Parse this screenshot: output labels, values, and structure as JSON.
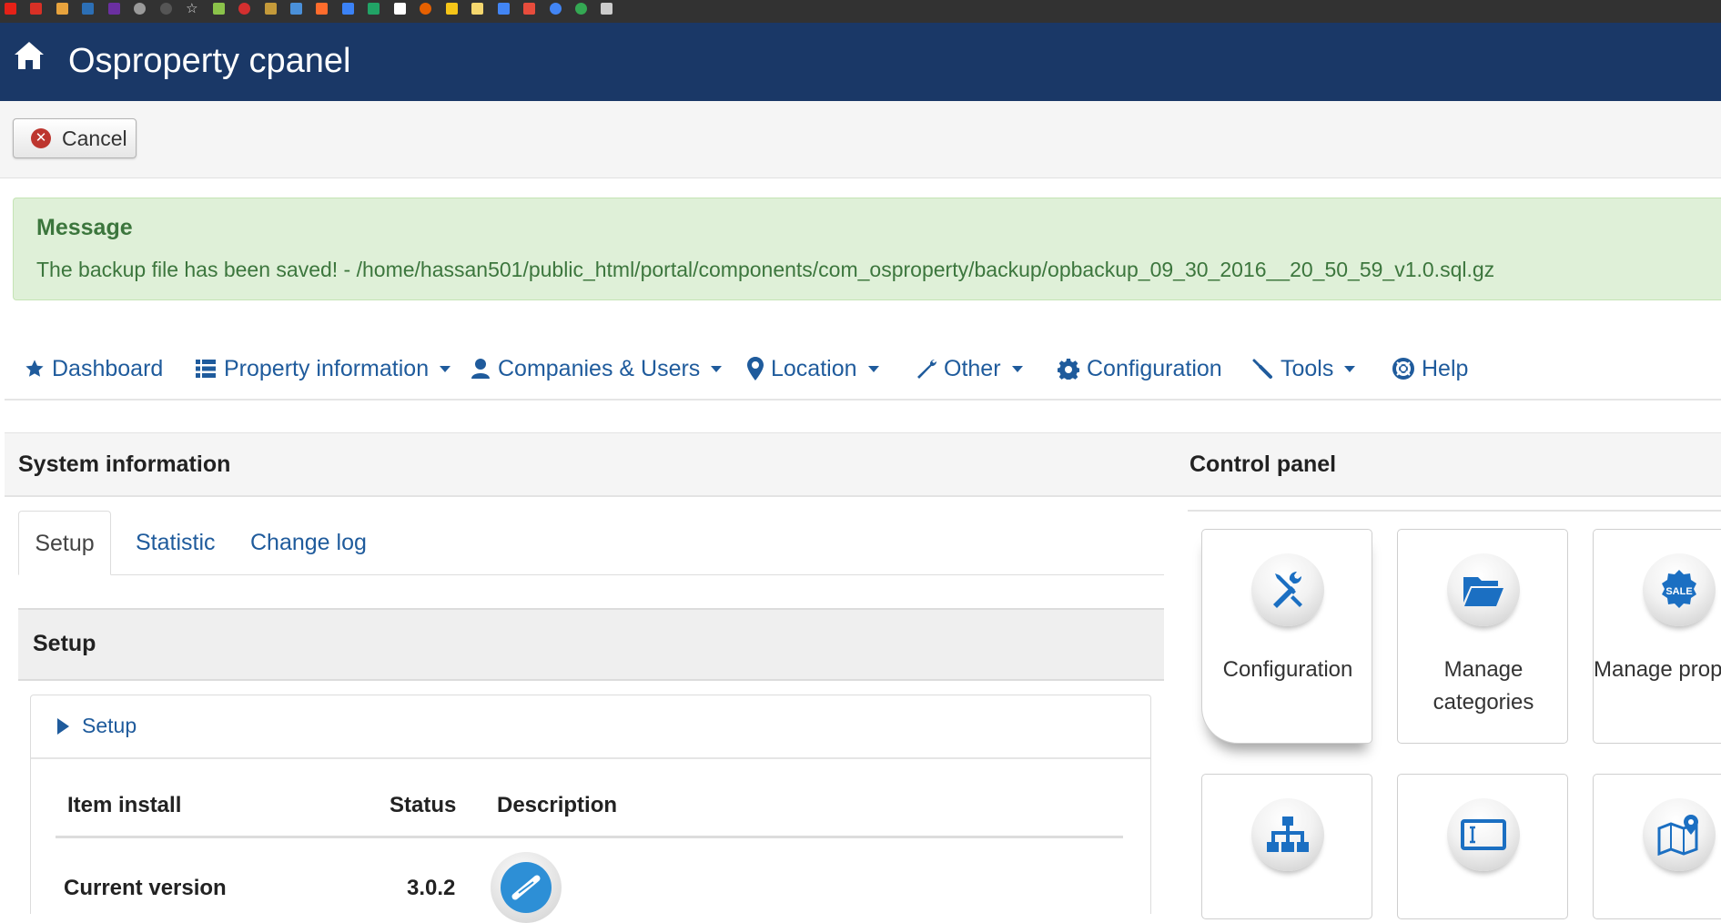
{
  "bookmarks": [
    {
      "icon": "youtube-icon",
      "color": "#e62117"
    },
    {
      "icon": "gmail-icon",
      "color": "#d93025"
    },
    {
      "icon": "bookmark-icon",
      "color": "#e8a33d"
    },
    {
      "icon": "m-icon",
      "color": "#2c6fb5"
    },
    {
      "icon": "yahoo-mail-icon",
      "color": "#6b2fa1"
    },
    {
      "icon": "apple-icon",
      "color": "#9a9a9a"
    },
    {
      "icon": "apple-icon-dim",
      "color": "#555555"
    },
    {
      "icon": "star-icon",
      "color": "#dddddd"
    },
    {
      "icon": "android-icon",
      "color": "#8bc34a"
    },
    {
      "icon": "opera-icon",
      "color": "#d32f2f"
    },
    {
      "icon": "fiverr-icon",
      "color": "#c49a3a"
    },
    {
      "icon": "docs-icon",
      "color": "#4a90d9"
    },
    {
      "icon": "cpanel-icon",
      "color": "#ff6c2c"
    },
    {
      "icon": "drive-icon",
      "color": "#3b82f6"
    },
    {
      "icon": "sheets-icon",
      "color": "#21a366"
    },
    {
      "icon": "medium-icon",
      "color": "#ffffff"
    },
    {
      "icon": "firefox-icon",
      "color": "#e66000"
    },
    {
      "icon": "bulb-icon",
      "color": "#f5c518"
    },
    {
      "icon": "note-icon",
      "color": "#f5d76e"
    },
    {
      "icon": "translate-icon",
      "color": "#4285f4"
    },
    {
      "icon": "puzzle-icon",
      "color": "#e74c3c"
    },
    {
      "icon": "google-icon",
      "color": "#4285f4"
    },
    {
      "icon": "google-icon-2",
      "color": "#34a853"
    },
    {
      "icon": "pin-icon",
      "color": "#cccccc"
    }
  ],
  "header": {
    "title": "Osproperty cpanel",
    "background": "#1a3867"
  },
  "toolbar": {
    "cancel_label": "Cancel"
  },
  "message": {
    "heading": "Message",
    "text": "The backup file has been saved! - /home/hassan501/public_html/portal/components/com_osproperty/backup/opbackup_09_30_2016__20_50_59_v1.0.sql.gz"
  },
  "nav": [
    {
      "label": "Dashboard",
      "icon": "star-icon",
      "dropdown": false
    },
    {
      "label": "Property information",
      "icon": "list-icon",
      "dropdown": true
    },
    {
      "label": "Companies & Users",
      "icon": "user-icon",
      "dropdown": true
    },
    {
      "label": "Location",
      "icon": "map-marker-icon",
      "dropdown": true
    },
    {
      "label": "Other",
      "icon": "wrench-icon",
      "dropdown": true
    },
    {
      "label": "Configuration",
      "icon": "gear-icon",
      "dropdown": false
    },
    {
      "label": "Tools",
      "icon": "screwdriver-icon",
      "dropdown": true
    },
    {
      "label": "Help",
      "icon": "lifebuoy-icon",
      "dropdown": false
    }
  ],
  "system_panel": {
    "title": "System information",
    "tabs": [
      "Setup",
      "Statistic",
      "Change log"
    ],
    "active_tab": "Setup",
    "section_title": "Setup",
    "toggle_label": "Setup",
    "table": {
      "headers": [
        "Item install",
        "Status",
        "Description"
      ],
      "rows": [
        {
          "item": "Current version",
          "status": "3.0.2"
        }
      ]
    }
  },
  "control_panel": {
    "title": "Control panel",
    "tiles": [
      {
        "label": "Configuration",
        "icon": "tools-icon"
      },
      {
        "label": "Manage categories",
        "icon": "folder-icon"
      },
      {
        "label": "Manage prop types",
        "icon": "sale-badge-icon"
      },
      {
        "label": "",
        "icon": "sitemap-icon"
      },
      {
        "label": "",
        "icon": "text-field-icon"
      },
      {
        "label": "",
        "icon": "map-icon"
      }
    ]
  },
  "colors": {
    "link": "#1f5b9c",
    "message_bg": "#dff0d8",
    "message_text": "#3c763d",
    "cancel_icon": "#bd362f"
  }
}
